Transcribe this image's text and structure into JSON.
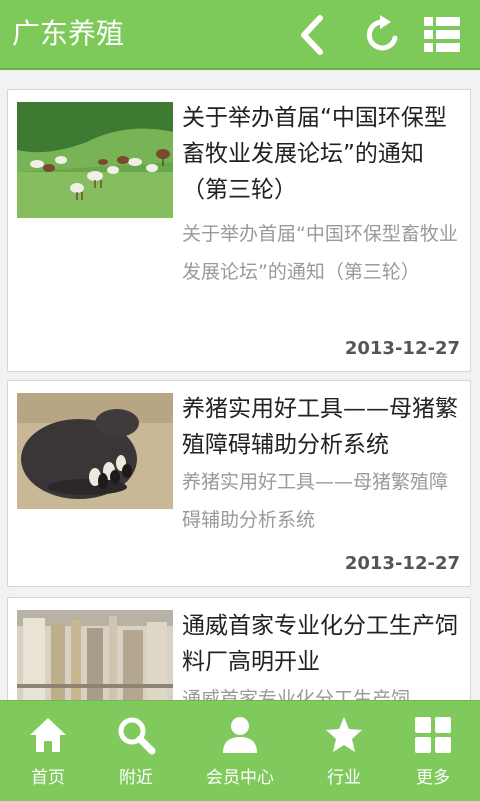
{
  "header": {
    "title": "广东养殖",
    "back_icon": "back-arrow-icon",
    "refresh_icon": "refresh-icon",
    "menu_icon": "list-menu-icon",
    "color": "#7dc95a"
  },
  "articles": [
    {
      "title": "关于举办首届“中国环保型畜牧业发展论坛”的通知（第三轮）",
      "summary": "关于举办首届“中国环保型畜牧业发展论坛”的通知（第三轮）",
      "date": "2013-12-27",
      "image": "goats-grazing-photo"
    },
    {
      "title": "养猪实用好工具——母猪繁殖障碍辅助分析系统",
      "summary": "养猪实用好工具——母猪繁殖障碍辅助分析系统",
      "date": "2013-12-27",
      "image": "sow-nursing-piglets-photo"
    },
    {
      "title": "通威首家专业化分工生产饲料厂高明开业",
      "summary": "通威首家专业化分工生产饲",
      "date": "",
      "image": "feed-factory-photo"
    }
  ],
  "tabbar": {
    "items": [
      {
        "label": "首页",
        "icon": "home-icon"
      },
      {
        "label": "附近",
        "icon": "search-icon"
      },
      {
        "label": "会员中心",
        "icon": "user-icon"
      },
      {
        "label": "行业",
        "icon": "star-icon"
      },
      {
        "label": "更多",
        "icon": "grid-icon"
      }
    ],
    "color": "#80c95d"
  }
}
